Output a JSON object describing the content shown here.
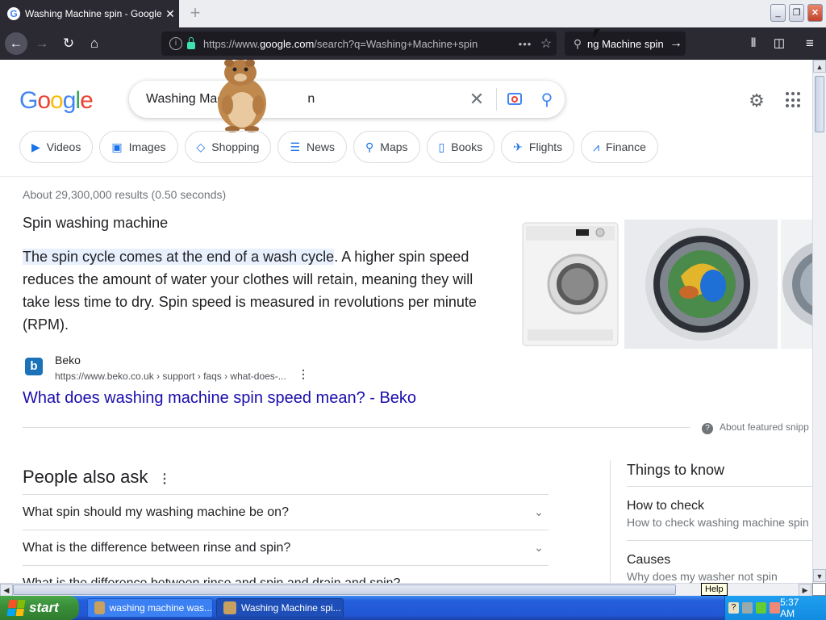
{
  "browser": {
    "tab_title": "Washing Machine spin - Google Se",
    "tab_favicon": "G",
    "new_tab": "+",
    "url_prefix": "https://www.",
    "url_domain": "google.com",
    "url_path": "/search?q=Washing+Machine+spin",
    "search_bar_text": "ng Machine spin",
    "window_controls": [
      "_",
      "❐",
      "✕"
    ]
  },
  "google": {
    "logo": [
      "G",
      "o",
      "o",
      "g",
      "l",
      "e"
    ],
    "logo_colors": [
      "#4285f4",
      "#ea4335",
      "#fbbc05",
      "#4285f4",
      "#34a853",
      "#ea4335"
    ],
    "query_visible": "Washing Mac",
    "query_tail": "n",
    "chips": [
      {
        "icon": "▶",
        "label": "Videos"
      },
      {
        "icon": "▣",
        "label": "Images"
      },
      {
        "icon": "◇",
        "label": "Shopping"
      },
      {
        "icon": "☰",
        "label": "News"
      },
      {
        "icon": "⚲",
        "label": "Maps"
      },
      {
        "icon": "▯",
        "label": "Books"
      },
      {
        "icon": "✈",
        "label": "Flights"
      },
      {
        "icon": "⩘",
        "label": "Finance"
      }
    ],
    "result_stats": "About 29,300,000 results (0.50 seconds)"
  },
  "featured": {
    "title": "Spin washing machine",
    "highlight": "The spin cycle comes at the end of a wash cycle",
    "text": ". A higher spin speed reduces the amount of water your clothes will retain, meaning they will take less time to dry. Spin speed is measured in revolutions per minute (RPM).",
    "source_icon": "b",
    "source_name": "Beko",
    "source_url": "https://www.beko.co.uk › support › faqs › what-does-...",
    "link": "What does washing machine spin speed mean? - Beko",
    "about": "About featured snipp"
  },
  "paa": {
    "title": "People also ask",
    "questions": [
      "What spin should my washing machine be on?",
      "What is the difference between rinse and spin?",
      "What is the difference between rinse and spin and drain and spin?"
    ]
  },
  "ttk": {
    "title": "Things to know",
    "items": [
      {
        "heading": "How to check",
        "sub": "How to check washing machine spin"
      },
      {
        "heading": "Causes",
        "sub": "Why does my washer not spin"
      }
    ]
  },
  "tooltip": "Help",
  "taskbar": {
    "start": "start",
    "tasks": [
      "washing machine was...",
      "Washing Machine spi..."
    ],
    "clock": "5:37 AM"
  },
  "colors": {
    "brand_blue": "#1a73e8",
    "link": "#1a0dab",
    "taskbar": "#245edb",
    "start": "#3a8f3a"
  }
}
